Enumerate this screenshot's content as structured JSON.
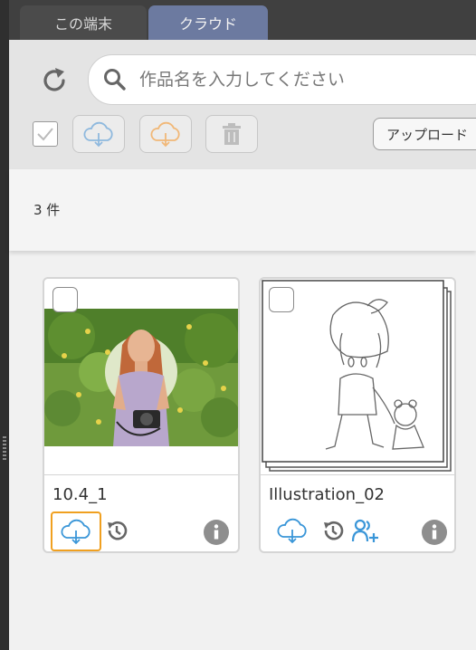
{
  "tabs": [
    {
      "label": "この端末",
      "active": false
    },
    {
      "label": "クラウド",
      "active": true
    }
  ],
  "toolbar": {
    "refresh_icon": "refresh-icon",
    "search_placeholder": "作品名を入力してください",
    "upload_label": "アップロード"
  },
  "count_text": "3 件",
  "colors": {
    "active_tab": "#6c7aa0",
    "cloud_blue": "#3a96d8",
    "cloud_orange": "#f0a020"
  },
  "cards": [
    {
      "title": "10.4_1",
      "icons": [
        "cloud-download-icon",
        "history-icon",
        "info-icon"
      ],
      "download_selected": true
    },
    {
      "title": "Illustration_02",
      "icons": [
        "cloud-download-icon",
        "history-icon",
        "share-users-icon",
        "info-icon"
      ],
      "download_selected": false
    }
  ]
}
